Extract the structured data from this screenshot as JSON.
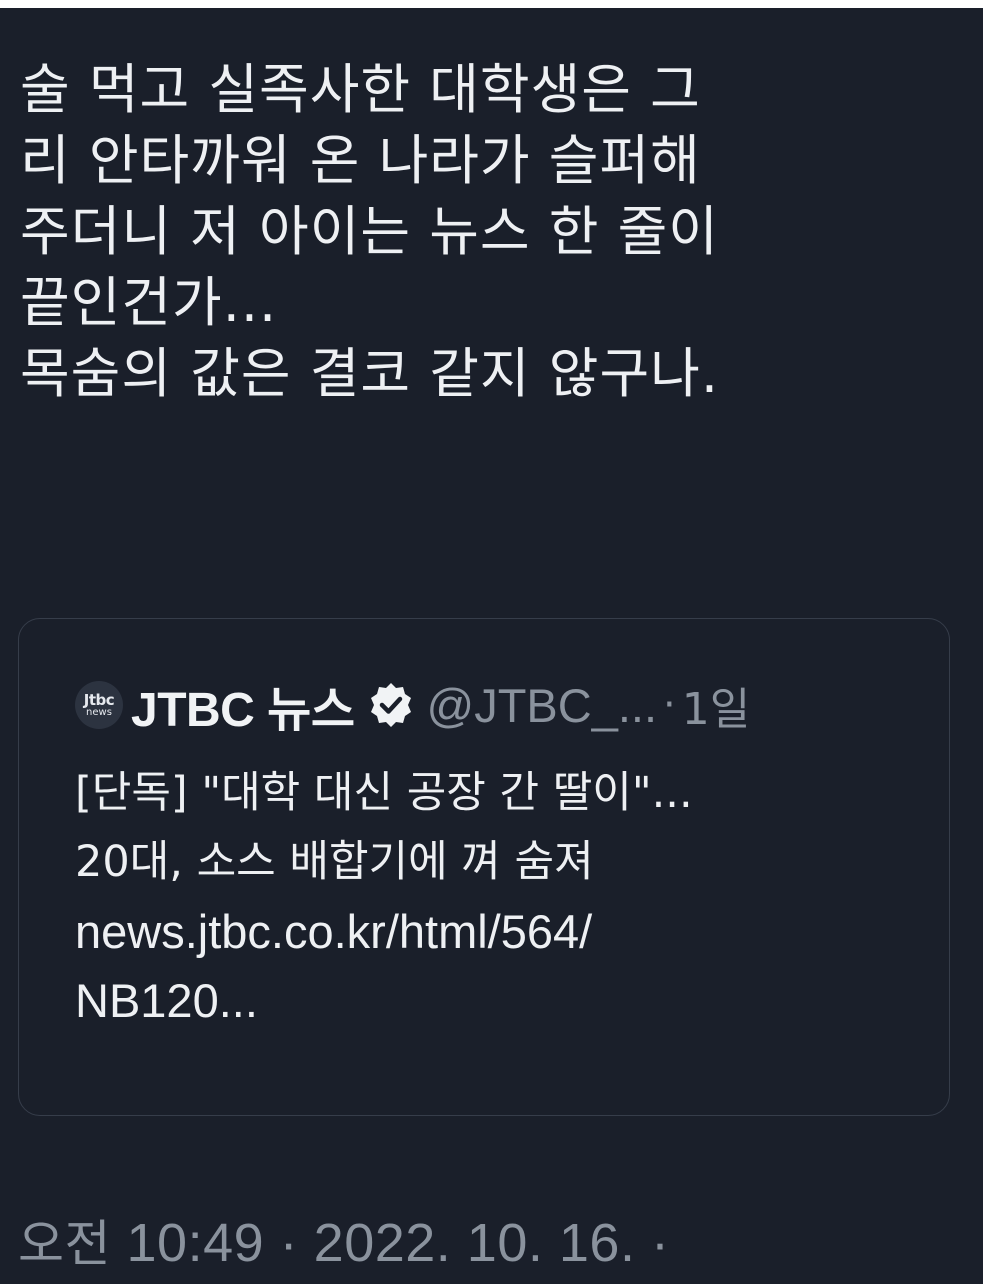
{
  "tweet": {
    "lines": [
      "술 먹고 실족사한 대학생은 그",
      "리 안타까워 온 나라가 슬퍼해",
      "주더니 저 아이는 뉴스 한 줄이",
      "끝인건가...",
      "목숨의 값은 결코 같지 않구나."
    ]
  },
  "quote": {
    "avatar_top": "Jtbc",
    "avatar_bottom": "news",
    "author_name": "JTBC 뉴스",
    "handle": "@JTBC_...",
    "separator": "·",
    "time_ago": "1일",
    "lines": [
      "[단독] \"대학 대신 공장 간 딸이\"...",
      "20대, 소스 배합기에 껴 숨져"
    ],
    "url_lines": [
      "news.jtbc.co.kr/html/564/",
      "NB120..."
    ]
  },
  "footer": {
    "ampm": "오전",
    "time": "10:49",
    "date": "2022. 10. 16.",
    "separator": "·"
  },
  "colors": {
    "background": "#1a1f2a",
    "text": "#eef0f3",
    "muted": "#8a929d",
    "border": "#363d4a"
  },
  "icons": {
    "verified": "verified-badge-icon",
    "avatar": "jtbc-news-logo"
  }
}
